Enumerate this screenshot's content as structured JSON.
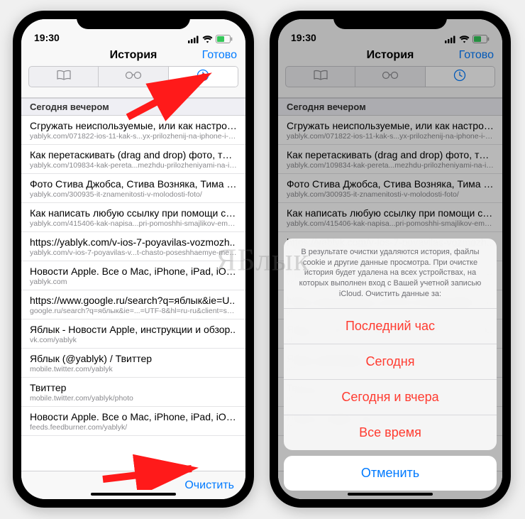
{
  "status": {
    "time": "19:30"
  },
  "nav": {
    "title": "История",
    "done": "Готово"
  },
  "section": "Сегодня вечером",
  "rows": [
    {
      "title": "Сгружать неиспользуемые, или как настрои..",
      "sub": "yablyk.com/071822-ios-11-kak-s...yx-prilozhenij-na-iphone-i-ipad/"
    },
    {
      "title": "Как перетаскивать (drag and drop) фото, тек..",
      "sub": "yablyk.com/109834-kak-pereta...mezhdu-prilozheniyami-na-ipad/"
    },
    {
      "title": "Фото Стива Джобса, Стива Возняка, Тима Ку..",
      "sub": "yablyk.com/300935-it-znamenitosti-v-molodosti-foto/"
    },
    {
      "title": "Как написать любую ссылку при помощи см..",
      "sub": "yablyk.com/415406-kak-napisa...pri-pomoshhi-smajlikov-emodzi/"
    },
    {
      "title": "https://yablyk.com/v-ios-7-poyavilas-vozmozh..",
      "sub": "yablyk.com/v-ios-7-poyavilas-v...t-chasto-poseshhaemye-mesta/"
    },
    {
      "title": "Новости Apple. Все о Mac, iPhone, iPad, iOS,..",
      "sub": "yablyk.com"
    },
    {
      "title": "https://www.google.ru/search?q=яблык&ie=U..",
      "sub": "google.ru/search?q=яблык&ie=...=UTF-8&hl=ru-ru&client=safari"
    },
    {
      "title": "Яблык - Новости Apple, инструкции и обзор..",
      "sub": "vk.com/yablyk"
    },
    {
      "title": "Яблык (@yablyk) / Твиттер",
      "sub": "mobile.twitter.com/yablyk"
    },
    {
      "title": "Твиттер",
      "sub": "mobile.twitter.com/yablyk/photo"
    },
    {
      "title": "Новости Apple. Все о Mac, iPhone, iPad, iOS,..",
      "sub": "feeds.feedburner.com/yablyk/"
    }
  ],
  "toolbar": {
    "clear": "Очистить"
  },
  "actionsheet": {
    "message": "В результате очистки удаляются история, файлы cookie и другие данные просмотра. При очистке история будет удалена на всех устройствах, на которых выполнен вход с Вашей учетной записью iCloud. Очистить данные за:",
    "options": [
      "Последний час",
      "Сегодня",
      "Сегодня и вчера",
      "Все время"
    ],
    "cancel": "Отменить"
  },
  "watermark": "ЯБлык"
}
